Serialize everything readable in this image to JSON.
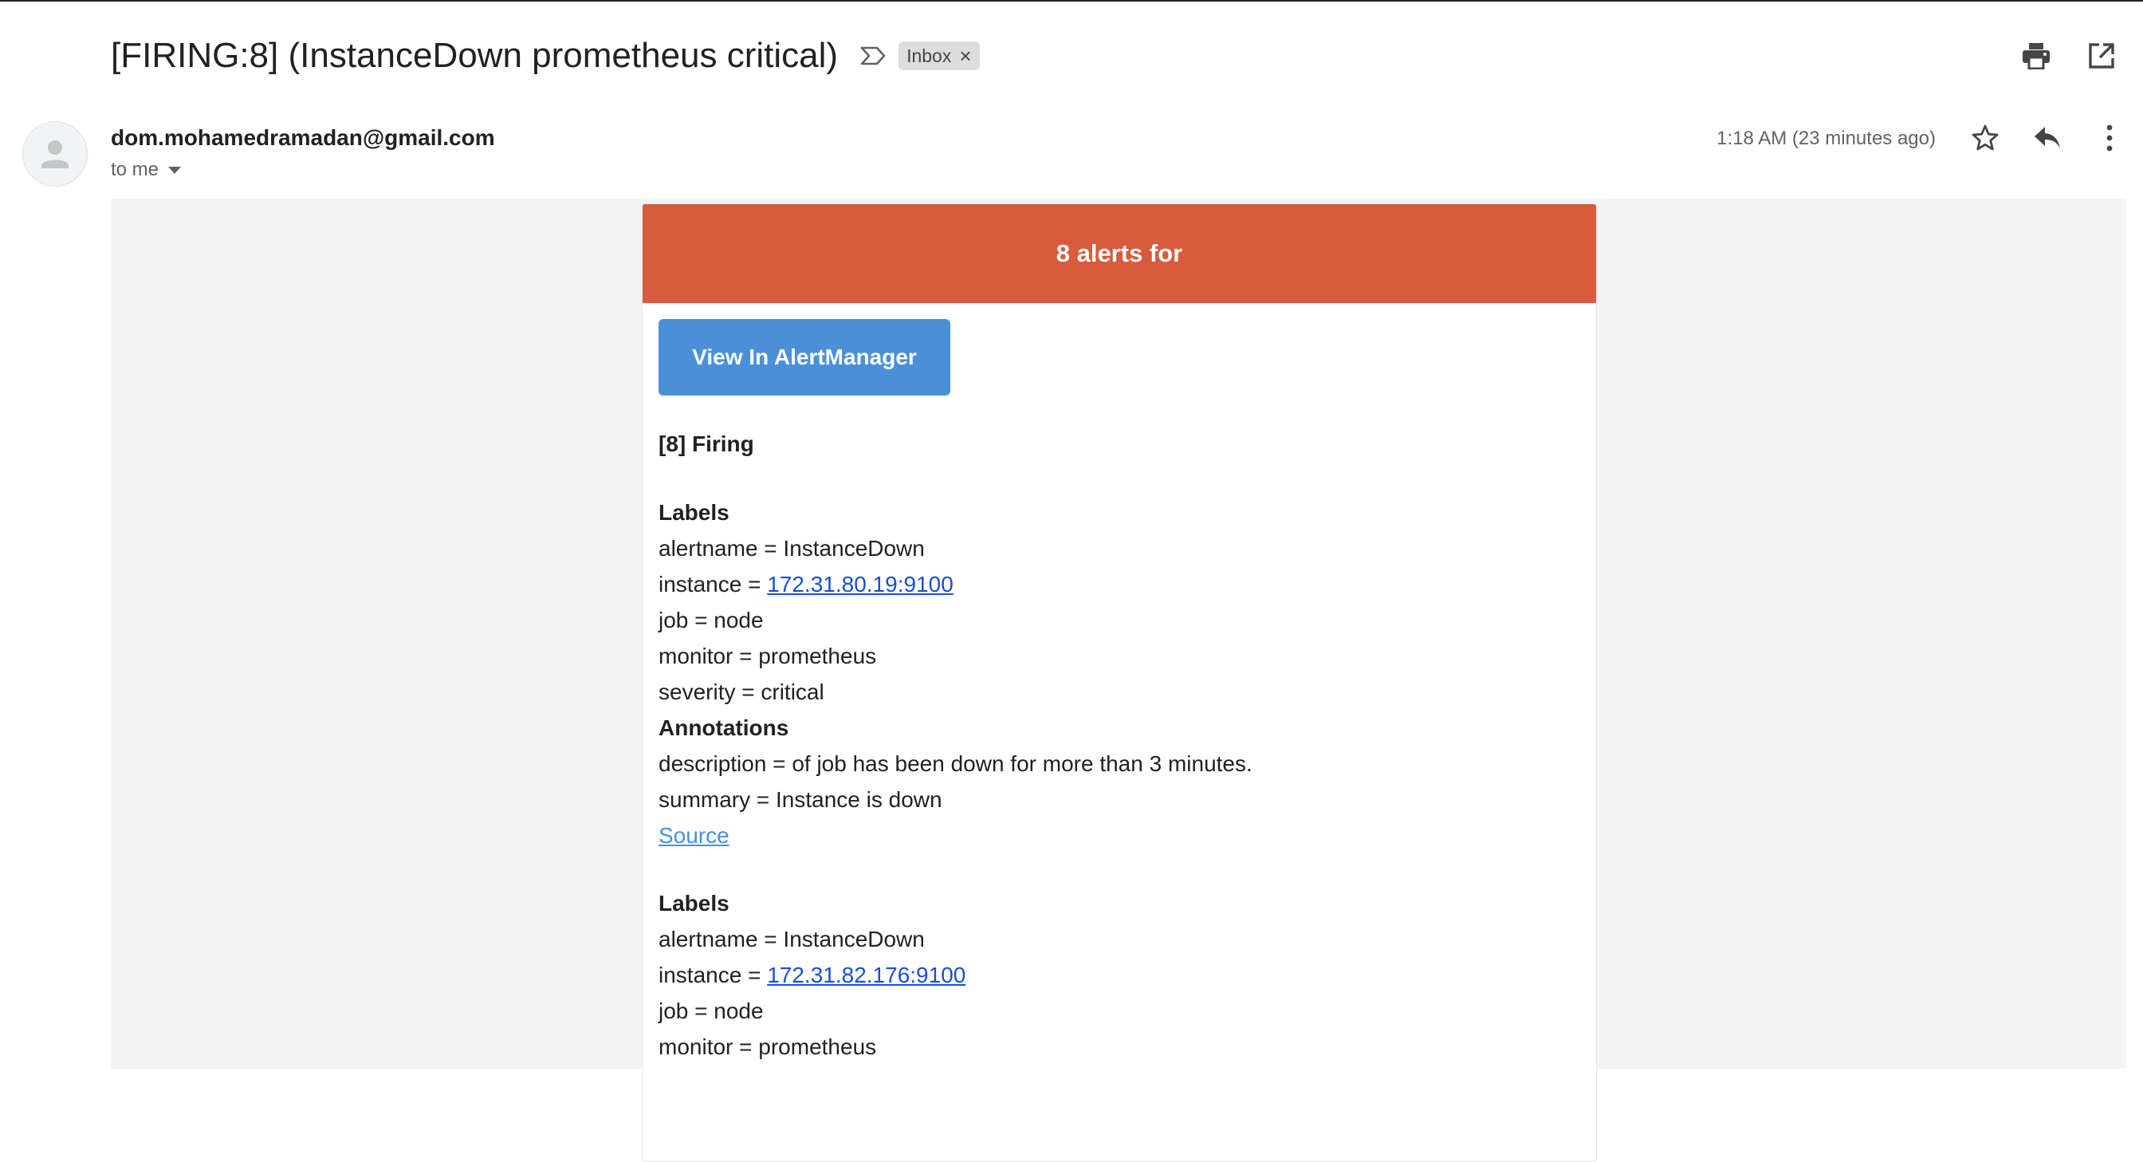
{
  "email": {
    "subject": "[FIRING:8] (InstanceDown prometheus critical)",
    "label_chip": "Inbox",
    "label_chip_close": "×",
    "sender": "dom.mohamedramadan@gmail.com",
    "recipient": "to me",
    "timestamp": "1:18 AM (23 minutes ago)"
  },
  "icons": {
    "label": "label-outline-icon",
    "print": "print-icon",
    "open_new_window": "open-in-new-icon",
    "star": "star-outline-icon",
    "reply": "reply-icon",
    "more": "more-vert-icon",
    "avatar": "person-icon"
  },
  "alert": {
    "header": "8 alerts for",
    "button": "View In AlertManager",
    "firing": "[8] Firing",
    "header_color": "#d75b3c",
    "button_color": "#4a90d9",
    "blocks": [
      {
        "labels_title": "Labels",
        "alertname": "alertname = InstanceDown",
        "instance_prefix": "instance = ",
        "instance": "172.31.80.19:9100",
        "job": "job = node",
        "monitor": "monitor = prometheus",
        "severity": "severity = critical",
        "annotations_title": "Annotations",
        "description": "description = of job has been down for more than 3 minutes.",
        "summary": "summary = Instance is down",
        "source": "Source"
      },
      {
        "labels_title": "Labels",
        "alertname": "alertname = InstanceDown",
        "instance_prefix": "instance = ",
        "instance": "172.31.82.176:9100",
        "job": "job = node",
        "monitor": "monitor = prometheus"
      }
    ]
  }
}
